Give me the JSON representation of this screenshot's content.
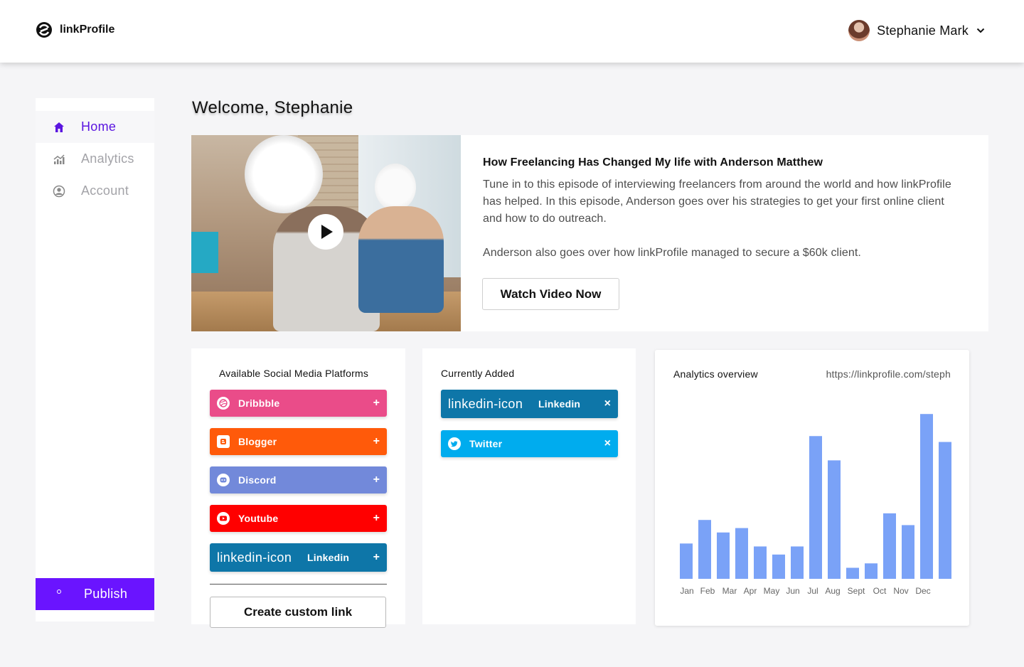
{
  "header": {
    "brand": "linkProfile",
    "user_name": "Stephanie Mark"
  },
  "sidebar": {
    "items": [
      {
        "label": "Home",
        "icon": "home-icon"
      },
      {
        "label": "Analytics",
        "icon": "analytics-icon"
      },
      {
        "label": "Account",
        "icon": "account-icon"
      }
    ],
    "publish_label": "Publish"
  },
  "main": {
    "welcome": "Welcome, Stephanie",
    "video": {
      "title": "How Freelancing Has Changed My life with Anderson Matthew",
      "desc1": "Tune in to this episode of interviewing freelancers from around the world and how linkProfile has helped. In this episode, Anderson goes over his strategies to get your first online client and how to do outreach.",
      "desc2": "Anderson also goes over how linkProfile managed to secure a $60k client.",
      "button": "Watch Video Now"
    },
    "available": {
      "title": "Available Social Media Platforms",
      "platforms": [
        {
          "label": "Dribbble",
          "color": "#ea4c89",
          "action": "+"
        },
        {
          "label": "Blogger",
          "color": "#ff5a0a",
          "action": "+"
        },
        {
          "label": "Discord",
          "color": "#7289da",
          "action": "+"
        },
        {
          "label": "Youtube",
          "color": "#ff0000",
          "action": "+"
        },
        {
          "label": "Linkedin",
          "icon_text": "linkedin-icon",
          "color": "#0e76a8",
          "action": "+"
        }
      ],
      "custom_button": "Create custom link"
    },
    "current": {
      "title": "Currently Added",
      "platforms": [
        {
          "label": "Linkedin",
          "icon_text": "linkedin-icon",
          "color": "#0e76a8",
          "action": "×"
        },
        {
          "label": "Twitter",
          "color": "#00acee",
          "action": "×"
        }
      ]
    },
    "analytics": {
      "title": "Analytics overview",
      "url": "https://linkprofile.com/steph"
    }
  },
  "chart_data": {
    "type": "bar",
    "categories": [
      "Jan",
      "Feb",
      "Mar",
      "Apr",
      "May",
      "Jun",
      "Jul",
      "Aug",
      "Sept",
      "Oct",
      "Nov",
      "Dec"
    ],
    "series": [
      {
        "values": [
          48,
          80,
          63,
          69,
          44,
          33,
          44,
          194,
          161,
          15,
          21,
          89,
          73,
          224,
          186
        ]
      }
    ],
    "xlabel": "",
    "ylabel": "",
    "ylim": [
      0,
      230
    ],
    "grid": false,
    "bar_color": "#7aa2f7"
  }
}
